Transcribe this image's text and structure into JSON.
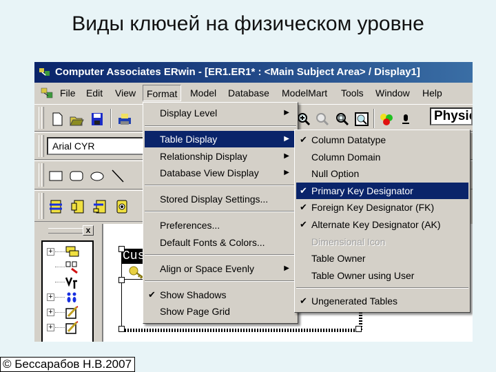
{
  "slide": {
    "title": "Виды ключей на физическом уровне",
    "footer": "© Бессарабов Н.В.2007"
  },
  "window": {
    "title": "Computer Associates ERwin - [ER1.ER1* : <Main Subject Area> / Display1]"
  },
  "menubar": {
    "items": [
      "File",
      "Edit",
      "View",
      "Format",
      "Model",
      "Database",
      "ModelMart",
      "Tools",
      "Window",
      "Help"
    ],
    "open": "Format"
  },
  "toolbar": {
    "font_value": "Arial CYR",
    "display_level_value": "Physical",
    "icons": [
      "new-icon",
      "open-icon",
      "save-icon",
      "print-icon",
      "zoom-in-icon",
      "zoom-out-icon",
      "zoom-fit-icon",
      "zoom-page-icon",
      "color-icon",
      "font-icon"
    ],
    "shape_icons": [
      "rectangle-icon",
      "rounded-rectangle-icon",
      "ellipse-icon",
      "line-icon"
    ],
    "entity_icons": [
      "entity-icon",
      "entity-left-icon",
      "entity-import-icon",
      "entity-target-icon"
    ]
  },
  "format_menu": {
    "items": [
      {
        "label": "Display Level",
        "submenu": true
      },
      {
        "label": "Table Display",
        "submenu": true,
        "highlighted": true
      },
      {
        "label": "Relationship Display",
        "submenu": true
      },
      {
        "label": "Database View Display",
        "submenu": true
      },
      {
        "label": "Stored Display Settings..."
      },
      {
        "label": "Preferences..."
      },
      {
        "label": "Default Fonts & Colors..."
      },
      {
        "label": "Align or Space Evenly",
        "submenu": true
      },
      {
        "label": "Show Shadows",
        "checked": true
      },
      {
        "label": "Show Page Grid"
      }
    ]
  },
  "table_display_menu": {
    "items": [
      {
        "label": "Column Datatype",
        "checked": true
      },
      {
        "label": "Column Domain"
      },
      {
        "label": "Null Option"
      },
      {
        "label": "Primary Key Designator",
        "checked": true,
        "highlighted": true
      },
      {
        "label": "Foreign Key Designator (FK)",
        "checked": true
      },
      {
        "label": "Alternate Key Designator (AK)",
        "checked": true
      },
      {
        "label": "Dimensional Icon",
        "disabled": true
      },
      {
        "label": "Table Owner"
      },
      {
        "label": "Table Owner using User"
      },
      {
        "label": "Ungenerated Tables",
        "checked": true
      }
    ]
  },
  "pane": {
    "close_label": "x"
  },
  "canvas": {
    "entity_title": "Cus"
  },
  "glyphs": {
    "check": "✔",
    "arrow": "▶"
  }
}
